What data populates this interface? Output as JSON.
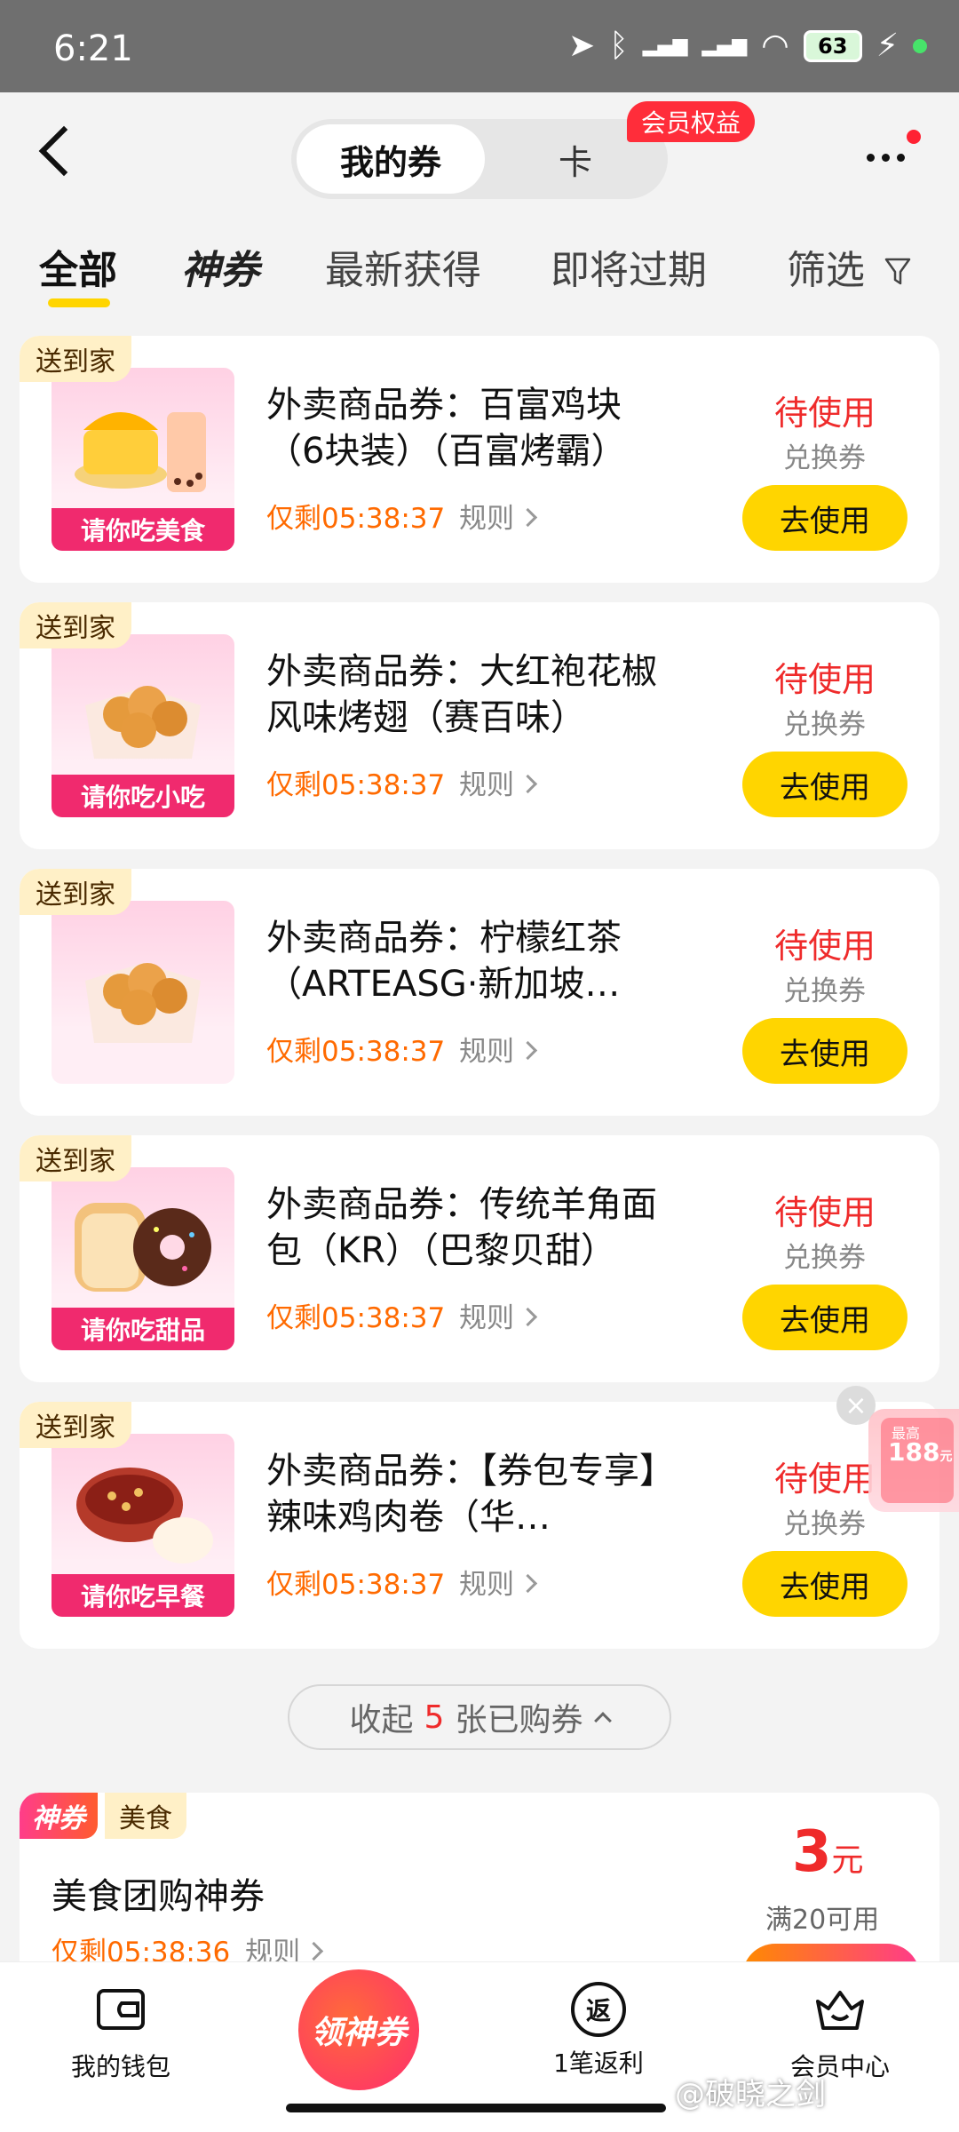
{
  "status_bar": {
    "time": "6:21",
    "battery": "63"
  },
  "header": {
    "tab_active": "我的券",
    "tab_other": "卡",
    "member_badge": "会员权益"
  },
  "tabs": {
    "all": "全部",
    "god": "神券",
    "newest": "最新获得",
    "expiring": "即将过期",
    "filter": "筛选"
  },
  "coupons": [
    {
      "tag": "送到家",
      "thumb_label": "请你吃美食",
      "title": "外卖商品券：百富鸡块（6块装）（百富烤霸）",
      "countdown": "仅剩05:38:37",
      "rule": "规则",
      "status": "待使用",
      "type": "兑换券",
      "button": "去使用"
    },
    {
      "tag": "送到家",
      "thumb_label": "请你吃小吃",
      "title": "外卖商品券：大红袍花椒风味烤翅（赛百味）",
      "countdown": "仅剩05:38:37",
      "rule": "规则",
      "status": "待使用",
      "type": "兑换券",
      "button": "去使用"
    },
    {
      "tag": "送到家",
      "thumb_label": "",
      "title": "外卖商品券：柠檬红茶（ARTEASG·新加坡…",
      "countdown": "仅剩05:38:37",
      "rule": "规则",
      "status": "待使用",
      "type": "兑换券",
      "button": "去使用"
    },
    {
      "tag": "送到家",
      "thumb_label": "请你吃甜品",
      "title": "外卖商品券：传统羊角面包（KR）（巴黎贝甜）",
      "countdown": "仅剩05:38:37",
      "rule": "规则",
      "status": "待使用",
      "type": "兑换券",
      "button": "去使用"
    },
    {
      "tag": "送到家",
      "thumb_label": "请你吃早餐",
      "title": "外卖商品券：【券包专享】辣味鸡肉卷（华…",
      "countdown": "仅剩05:38:37",
      "rule": "规则",
      "status": "待使用",
      "type": "兑换券",
      "button": "去使用"
    }
  ],
  "floating": {
    "top": "最高",
    "amount": "188",
    "unit": "元",
    "close": "×"
  },
  "collapse": {
    "prefix": "收起",
    "count": "5",
    "suffix": "张已购券"
  },
  "god_coupon": {
    "tag": "神券",
    "category": "美食",
    "title": "美食团购神券",
    "countdown": "仅剩05:38:36",
    "rule": "规则",
    "price": "3",
    "price_unit": "元",
    "condition": "满20可用"
  },
  "bottom_nav": {
    "wallet": "我的钱包",
    "center": "领神券",
    "rebate": "1笔返利",
    "rebate_icon": "返",
    "member": "会员中心"
  },
  "watermark": "@破晓之剑",
  "colors": {
    "accent": "#ffd500",
    "status_red": "#ef2b2b",
    "countdown_orange": "#ff6a00",
    "thumb_label_pink": "#f02a6e"
  }
}
